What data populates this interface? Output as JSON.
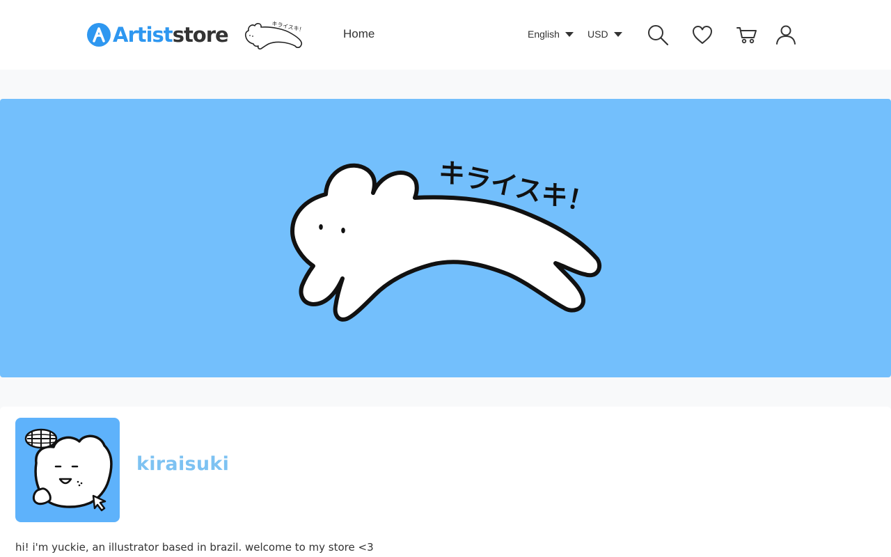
{
  "brand": {
    "logo_part1": "Artist",
    "logo_part2": "store",
    "accent_color": "#2e97f0",
    "store_logo_text": "キライスキ！"
  },
  "nav": {
    "home_label": "Home"
  },
  "header": {
    "language": "English",
    "currency": "USD",
    "icons": [
      "search-icon",
      "heart-icon",
      "cart-icon",
      "user-icon"
    ]
  },
  "banner": {
    "background_color": "#73bffc",
    "lettering": "キライスキ！"
  },
  "profile": {
    "store_name": "kiraisuki",
    "store_name_color": "#7dc2f2",
    "bio": "hi! i'm yuckie, an illustrator based in brazil. welcome to my store <3",
    "avatar_color": "#5eb2fb"
  }
}
